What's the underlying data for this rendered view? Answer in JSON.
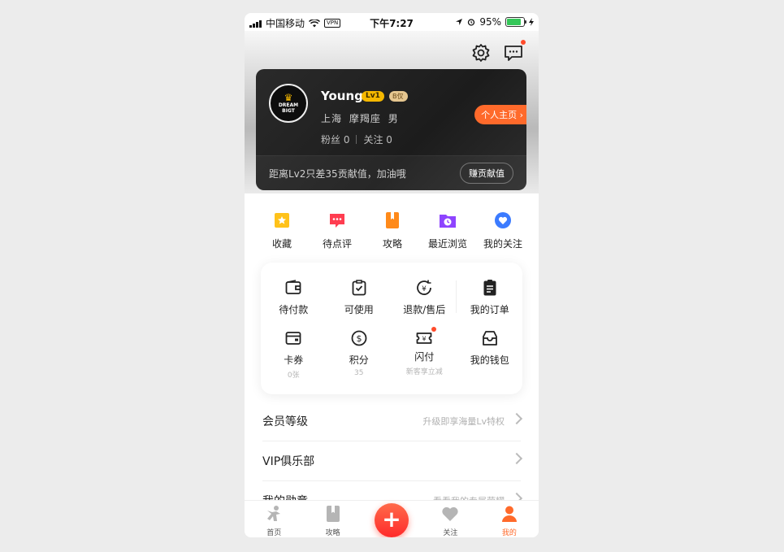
{
  "status": {
    "carrier": "中国移动",
    "vpn": "VPN",
    "time": "下午7:27",
    "battery": "95%",
    "battery_level": 0.95
  },
  "profile": {
    "name": "Young",
    "level_badge": "Lv1",
    "b_badge": "B仅",
    "avatar_text": [
      "DREAM",
      "BIGT"
    ],
    "city": "上海",
    "zodiac": "摩羯座",
    "gender": "男",
    "fans_label": "粉丝 0",
    "follow_label": "关注 0",
    "home_button": "个人主页",
    "progress_text": "距离Lv2只差35贡献值，加油哦",
    "earn_button": "赚贡献值"
  },
  "quick_links": [
    {
      "label": "收藏",
      "icon": "star-bookmark-icon",
      "color": "#ffc21a"
    },
    {
      "label": "待点评",
      "icon": "comment-icon",
      "color": "#ff3d50"
    },
    {
      "label": "攻略",
      "icon": "guide-book-icon",
      "color": "#ff8a1a"
    },
    {
      "label": "最近浏览",
      "icon": "history-clock-icon",
      "color": "#8e44ff"
    },
    {
      "label": "我的关注",
      "icon": "heart-circle-icon",
      "color": "#3b7bff"
    }
  ],
  "orders": {
    "row1": [
      {
        "label": "待付款",
        "icon": "wallet-icon"
      },
      {
        "label": "可使用",
        "icon": "clipboard-check-icon"
      },
      {
        "label": "退款/售后",
        "icon": "refund-icon"
      },
      {
        "label": "我的订单",
        "icon": "order-list-icon"
      }
    ],
    "row2": [
      {
        "label": "卡券",
        "sub": "0张",
        "icon": "coupon-card-icon"
      },
      {
        "label": "积分",
        "sub": "35",
        "icon": "points-coin-icon"
      },
      {
        "label": "闪付",
        "sub": "新客享立减",
        "icon": "quick-pay-icon"
      },
      {
        "label": "我的钱包",
        "sub": "",
        "icon": "purse-icon"
      }
    ]
  },
  "menu": [
    {
      "label": "会员等级",
      "hint": "升级即享海量Lv特权"
    },
    {
      "label": "VIP俱乐部",
      "hint": ""
    },
    {
      "label": "我的勋章",
      "hint": "看看我的专属荣耀"
    }
  ],
  "tabs": [
    {
      "label": "首页",
      "icon": "home-figure-icon"
    },
    {
      "label": "攻略",
      "icon": "guide-book-icon"
    },
    {
      "label": "+",
      "icon": "plus-icon"
    },
    {
      "label": "关注",
      "icon": "heart-icon"
    },
    {
      "label": "我的",
      "icon": "user-icon"
    }
  ],
  "colors": {
    "accent": "#ff6a2b",
    "gold": "#f5b800",
    "card_dark": "#222222"
  }
}
